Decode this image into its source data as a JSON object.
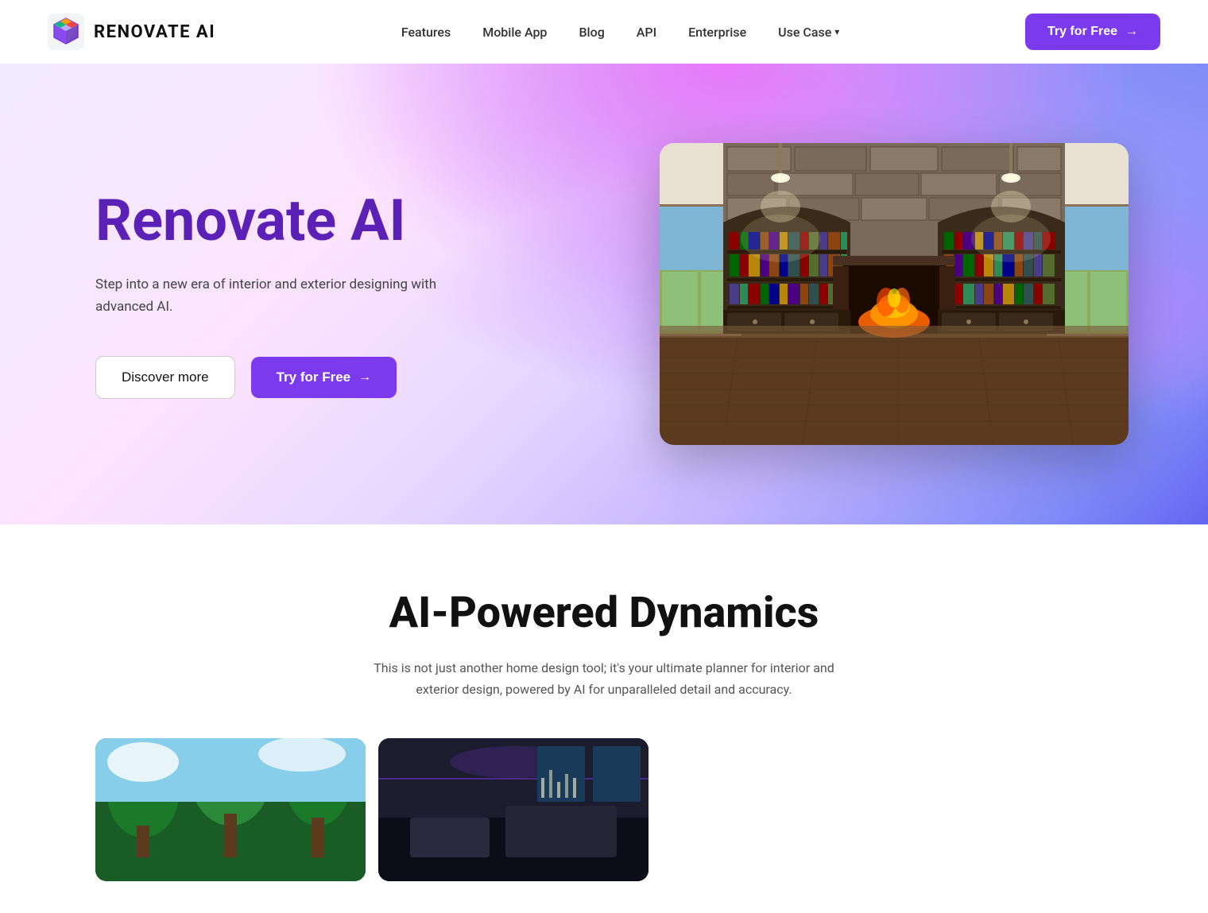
{
  "brand": {
    "logo_text": "RENOVATE AI",
    "logo_icon_alt": "Renovate AI Logo"
  },
  "navbar": {
    "links": [
      {
        "label": "Features",
        "href": "#"
      },
      {
        "label": "Mobile App",
        "href": "#"
      },
      {
        "label": "Blog",
        "href": "#"
      },
      {
        "label": "API",
        "href": "#"
      },
      {
        "label": "Enterprise",
        "href": "#"
      },
      {
        "label": "Use Case",
        "href": "#",
        "has_chevron": true
      }
    ],
    "cta_label": "Try for Free",
    "cta_arrow": "→"
  },
  "hero": {
    "title": "Renovate AI",
    "subtitle": "Step into a new era of interior and exterior designing with advanced AI.",
    "discover_btn": "Discover more",
    "try_btn": "Try for Free",
    "try_arrow": "→"
  },
  "ai_section": {
    "title": "AI-Powered Dynamics",
    "subtitle": "This is not just another home design tool; it's your ultimate planner for interior and exterior design, powered by AI for unparalleled detail and accuracy."
  },
  "colors": {
    "primary": "#7c3aed",
    "primary_dark": "#6d28d9",
    "title_purple": "#5b21b6"
  }
}
